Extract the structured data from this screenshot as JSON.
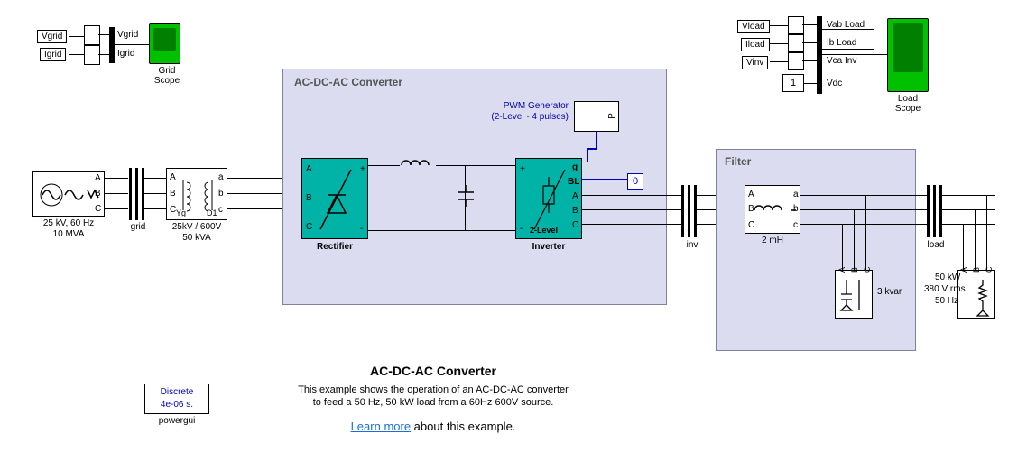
{
  "tags": {
    "vgrid": "Vgrid",
    "igrid": "Igrid",
    "vload": "Vload",
    "iload": "Iload",
    "vinv": "Vinv"
  },
  "gridScope": {
    "line1": "Vgrid",
    "line2": "Igrid",
    "label": "Grid\nScope"
  },
  "source": {
    "line1": "25 kV, 60 Hz",
    "line2": "10 MVA",
    "pA": "A",
    "pB": "B",
    "pC": "C"
  },
  "busGrid": "grid",
  "xfmr": {
    "line1": "25kV / 600V",
    "line2": "50 kVA",
    "pA": "A",
    "pB": "B",
    "pC": "C",
    "sa": "a",
    "sb": "b",
    "sc": "c",
    "yg": "Yg",
    "d1": "D1"
  },
  "conv": {
    "title": "AC-DC-AC Converter",
    "rect": "Rectifier",
    "inv": "Inverter",
    "twolevel": "2-Level",
    "pwm1": "PWM Generator",
    "pwm2": "(2-Level - 4 pulses)",
    "pA": "A",
    "pB": "B",
    "pC": "C",
    "g": "g",
    "bl": "BL",
    "zero": "0",
    "pP": "P",
    "plus": "+",
    "minus": "-"
  },
  "busInv": "inv",
  "filter": {
    "title": "Filter",
    "ind": "2 mH",
    "cap": "3 kvar",
    "pA": "A",
    "pB": "B",
    "pC": "C",
    "sa": "a",
    "sb": "b",
    "sc": "c"
  },
  "busLoad": "load",
  "load": {
    "line1": "50 kW",
    "line2": "380 V rms",
    "line3": "50 Hz",
    "pA": "A",
    "pB": "B",
    "pC": "C"
  },
  "loadScope": {
    "l1": "Vab Load",
    "l2": "Ib Load",
    "l3": "Vca Inv",
    "l4": "Vdc",
    "label": "Load\nScope",
    "one": "1"
  },
  "powergui": {
    "line1": "Discrete",
    "line2": "4e-06 s.",
    "label": "powergui"
  },
  "footer": {
    "title": "AC-DC-AC Converter",
    "d1": "This example shows the operation of an AC-DC-AC converter",
    "d2": "to feed a 50 Hz, 50 kW load from a 60Hz 600V source.",
    "link": "Learn more",
    "after": " about this example."
  }
}
